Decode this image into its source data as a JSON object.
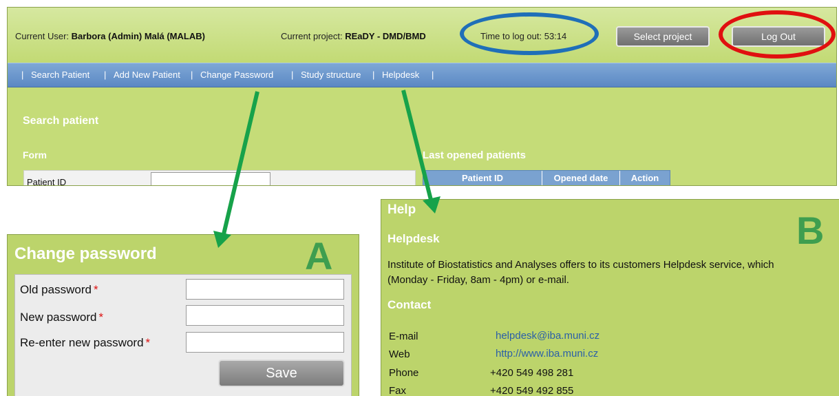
{
  "header": {
    "current_user_label": "Current User:",
    "current_user_value": "Barbora (Admin) Malá (MALAB)",
    "current_project_label": "Current project:",
    "current_project_value": "REaDY - DMD/BMD",
    "time_to_logout": "Time to log out: 53:14",
    "select_project_label": "Select project",
    "logout_label": "Log Out"
  },
  "nav": {
    "items": [
      "Search Patient",
      "Add New Patient",
      "Change Password",
      "Study structure",
      "Helpdesk"
    ]
  },
  "search": {
    "title": "Search patient",
    "form_title": "Form",
    "patient_id_label": "Patient ID",
    "last_opened_title": "Last opened patients",
    "columns": [
      "Patient ID",
      "Opened date",
      "Action"
    ]
  },
  "panelA": {
    "letter": "A",
    "title": "Change password",
    "old_password_label": "Old password",
    "new_password_label": "New password",
    "reenter_label": "Re-enter new password",
    "required_mark": "*",
    "save_label": "Save"
  },
  "panelB": {
    "letter": "B",
    "title": "Help",
    "helpdesk_heading": "Helpdesk",
    "helpdesk_text_1": "Institute of Biostatistics and Analyses offers to its customers Helpdesk service, which",
    "helpdesk_text_2": "(Monday - Friday, 8am - 4pm) or e-mail.",
    "contact_heading": "Contact",
    "contact": {
      "email_label": "E-mail",
      "email_value": "helpdesk@iba.muni.cz",
      "web_label": "Web",
      "web_value": "http://www.iba.muni.cz",
      "phone_label": "Phone",
      "phone_value": "+420 549 498 281",
      "fax_label": "Fax",
      "fax_value": "+420 549 492 855"
    }
  },
  "colors": {
    "panel_green": "#bcd46b",
    "nav_blue": "#6b96cc",
    "highlight_blue": "#1f6fb8",
    "highlight_red": "#e01010",
    "arrow_green": "#17a24a",
    "letter_green": "#3e9e4f"
  }
}
